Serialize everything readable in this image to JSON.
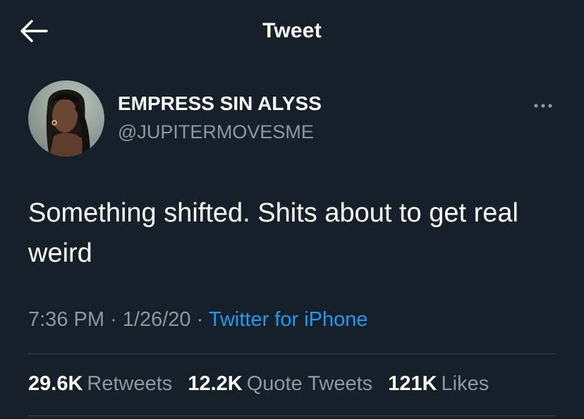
{
  "header": {
    "title": "Tweet",
    "back_icon": "arrow-left-icon"
  },
  "author": {
    "display_name": "EMPRESS SIN ALYSS",
    "handle": "@JUPITERMOVESME",
    "avatar_icon": "profile-photo"
  },
  "more_icon": "more-horizontal-icon",
  "tweet": {
    "text": "Something shifted. Shits about to get real weird"
  },
  "meta": {
    "time": "7:36 PM",
    "separator": "·",
    "date": "1/26/20",
    "source": "Twitter for iPhone"
  },
  "stats": {
    "retweets_count": "29.6K",
    "retweets_label": "Retweets",
    "quotes_count": "12.2K",
    "quotes_label": "Quote Tweets",
    "likes_count": "121K",
    "likes_label": "Likes"
  },
  "colors": {
    "background": "#15202b",
    "text_primary": "#ffffff",
    "text_secondary": "#8b98a5",
    "link": "#1d9bf0",
    "divider": "#38444d"
  }
}
